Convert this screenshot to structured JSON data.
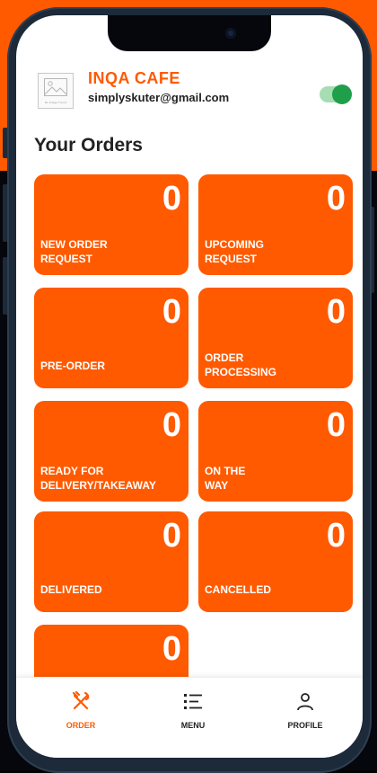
{
  "colors": {
    "brand": "#ff5a00",
    "toggle_on": "#1f9f4a",
    "text": "#222222"
  },
  "header": {
    "logo_caption": "No Image Found",
    "cafe_name": "INQA CAFE",
    "email": "simplyskuter@gmail.com",
    "online_toggle": true
  },
  "section_title": "Your Orders",
  "orders": [
    {
      "label": "NEW ORDER\nREQUEST",
      "count": "0"
    },
    {
      "label": "UPCOMING\nREQUEST",
      "count": "0"
    },
    {
      "label": "PRE-ORDER",
      "count": "0"
    },
    {
      "label": "ORDER\nPROCESSING",
      "count": "0"
    },
    {
      "label": "READY FOR\nDELIVERY/TAKEAWAY",
      "count": "0"
    },
    {
      "label": "ON THE\nWAY",
      "count": "0"
    },
    {
      "label": "DELIVERED",
      "count": "0"
    },
    {
      "label": "CANCELLED",
      "count": "0"
    },
    {
      "label": "",
      "count": "0"
    }
  ],
  "nav": {
    "order": {
      "label": "ORDER",
      "icon": "fork-knife-icon",
      "active": true
    },
    "menu": {
      "label": "MENU",
      "icon": "list-icon"
    },
    "profile": {
      "label": "PROFILE",
      "icon": "user-icon"
    }
  }
}
